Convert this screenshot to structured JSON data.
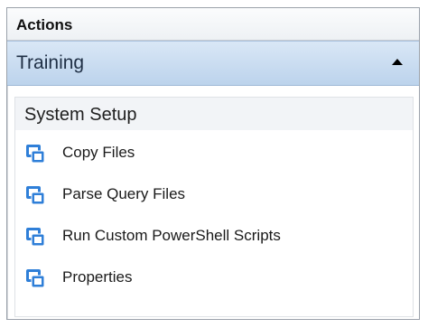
{
  "panel": {
    "title": "Actions"
  },
  "section": {
    "label": "Training",
    "expanded": true
  },
  "group": {
    "title": "System Setup",
    "actions": [
      {
        "label": "Copy Files",
        "icon": "action-window-icon"
      },
      {
        "label": "Parse Query Files",
        "icon": "action-window-icon"
      },
      {
        "label": "Run Custom PowerShell Scripts",
        "icon": "action-window-icon"
      },
      {
        "label": "Properties",
        "icon": "action-window-icon"
      }
    ]
  },
  "colors": {
    "header_gradient_top": "#d9e7f6",
    "header_gradient_bottom": "#bcd3ec",
    "icon_blue": "#2f7fd8"
  }
}
